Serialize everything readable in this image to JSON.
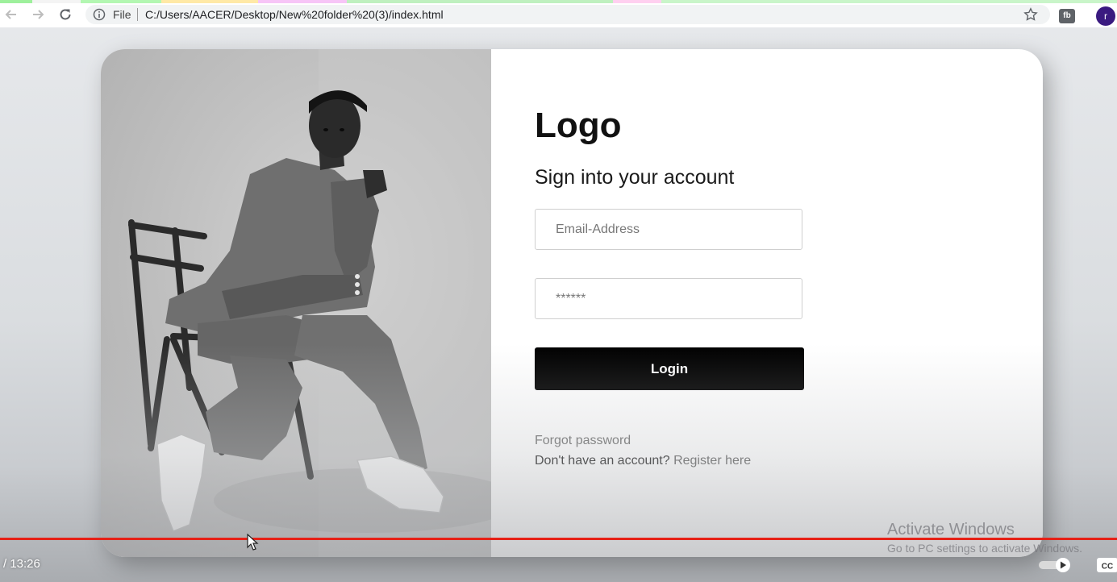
{
  "browser": {
    "url_scheme": "File",
    "url": "C:/Users/AACER/Desktop/New%20folder%20(3)/index.html",
    "extension_label": "fb",
    "profile_initial": "r",
    "icons": [
      "back-arrow-icon",
      "forward-arrow-icon",
      "reload-icon",
      "info-icon",
      "star-icon"
    ]
  },
  "login": {
    "logo": "Logo",
    "heading": "Sign into your account",
    "email_placeholder": "Email-Address",
    "password_placeholder": "******",
    "button_label": "Login",
    "forgot_password": "Forgot password",
    "no_account_text": "Don't have an account?",
    "register_link": "Register here"
  },
  "watermark": {
    "title": "Activate Windows",
    "subtitle": "Go to PC settings to activate Windows."
  },
  "video": {
    "time": "/ 13:26",
    "cc_label": "CC",
    "progress_color": "#e62117"
  },
  "colors": {
    "button_bg": "#000000",
    "button_text": "#ffffff",
    "avatar_bg": "#3a1a80"
  }
}
